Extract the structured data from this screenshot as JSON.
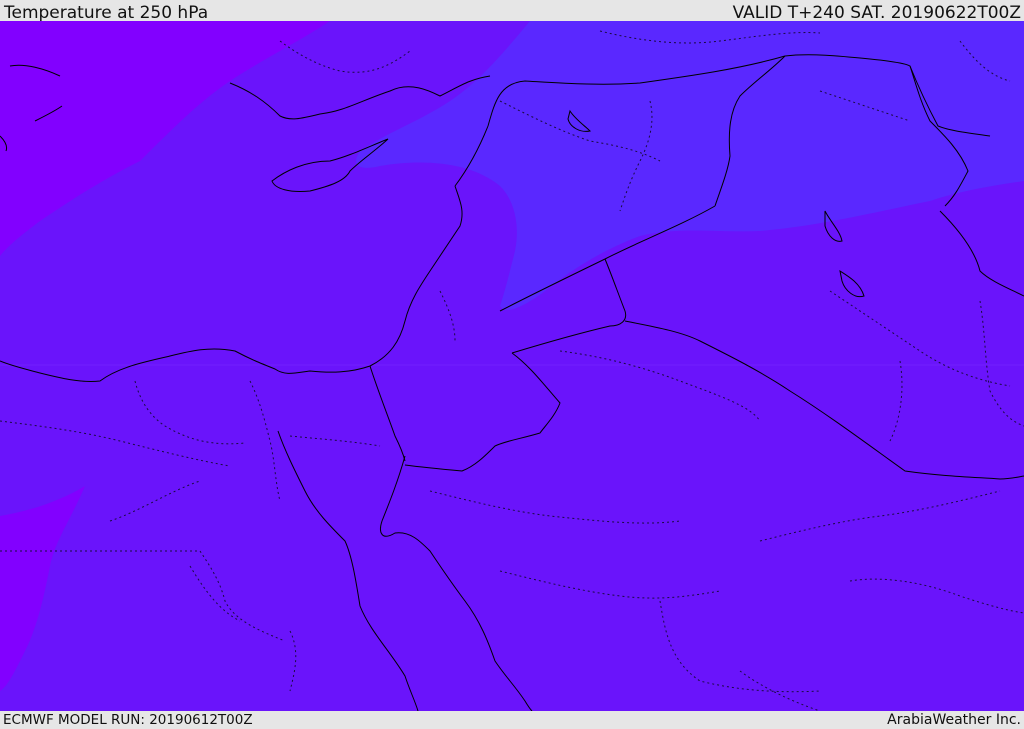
{
  "header": {
    "title": "Temperature at 250 hPa",
    "valid": "VALID T+240 SAT. 20190622T00Z"
  },
  "footer": {
    "model_run": "ECMWF MODEL RUN: 20190612T00Z",
    "credit": "ArabiaWeather Inc."
  },
  "map": {
    "field": "temperature",
    "level": "250 hPa",
    "colors": {
      "coldest": "#8000ff",
      "mid": "#6c14fb",
      "warmest": "#5a28ff",
      "coast": "#000000"
    }
  }
}
